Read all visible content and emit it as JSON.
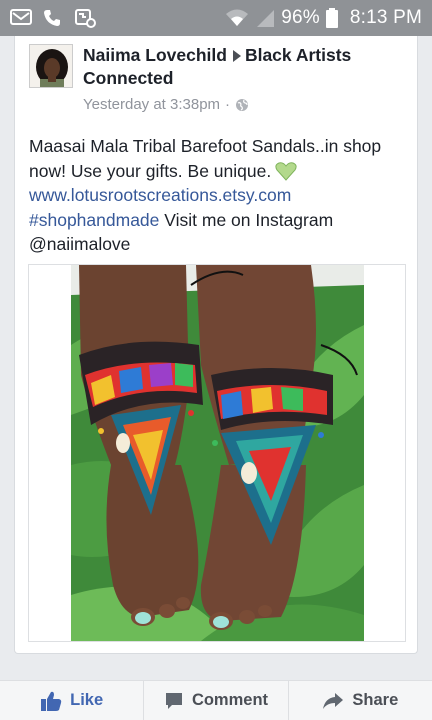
{
  "status_bar": {
    "icons": [
      "mail-icon",
      "phone-icon",
      "phone-settings-icon",
      "wifi-icon",
      "signal-icon",
      "battery-icon"
    ],
    "battery": "96%",
    "time": "8:13 PM"
  },
  "post": {
    "author": "Naiima Lovechild",
    "group": "Black Artists Connected",
    "timestamp": "Yesterday at 3:38pm",
    "separator": "·",
    "audience_icon": "globe-icon",
    "text_line1": "Maasai Mala Tribal Barefoot Sandals..in shop now! Use your gifts. Be unique.",
    "heart_emoji": "green-heart-icon",
    "link": "www.lotusrootscreations.etsy.com",
    "hashtag": "#shophandmade",
    "text_line2": "Visit me on Instagram @naiimalove",
    "image": "photo of beaded barefoot sandals on feet over green leaves"
  },
  "actions": {
    "like": "Like",
    "comment": "Comment",
    "share": "Share"
  },
  "colors": {
    "status_bar": "#8f9296",
    "link": "#365899",
    "like": "#4267b2",
    "text": "#1d2129",
    "meta": "#90949c"
  }
}
